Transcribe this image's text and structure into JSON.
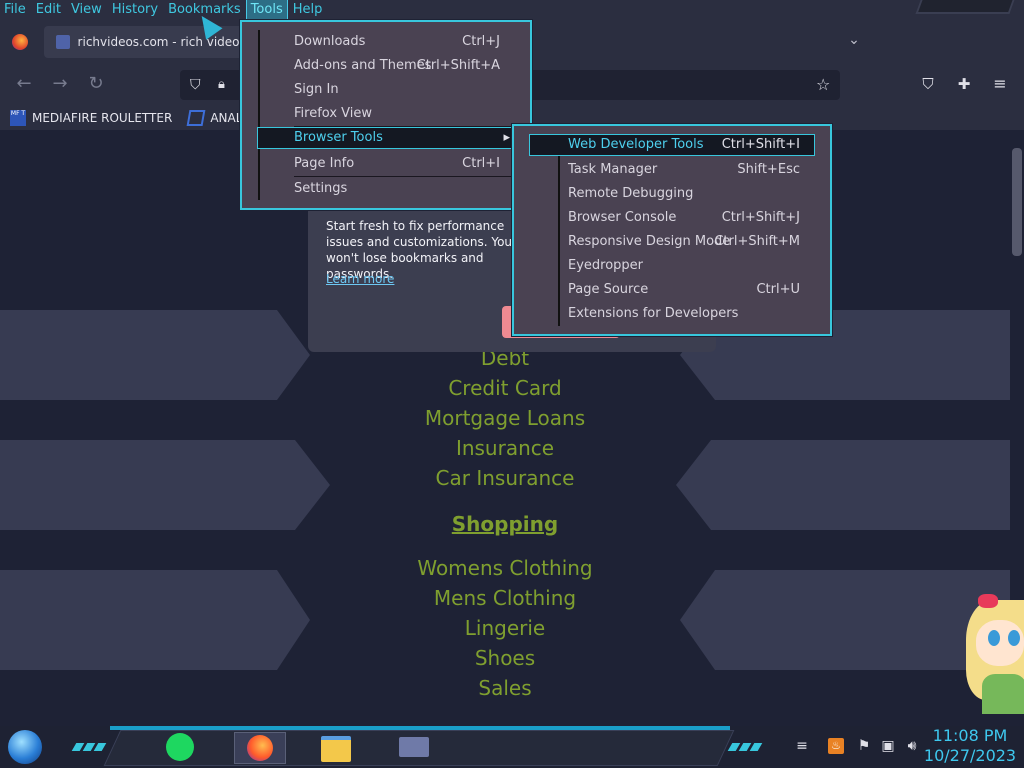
{
  "menubar": {
    "items": [
      "File",
      "Edit",
      "View",
      "History",
      "Bookmarks",
      "Tools",
      "Help"
    ]
  },
  "tab": {
    "title": "richvideos.com - rich videos R"
  },
  "bookmarks": {
    "items": [
      "MEDIAFIRE ROULETTER",
      "ANAL PRO"
    ],
    "icon_text": "MF T"
  },
  "page": {
    "links_top": [
      "Debt",
      "Credit Card",
      "Mortgage Loans",
      "Insurance",
      "Car Insurance"
    ],
    "section_title": "Shopping",
    "links_bottom": [
      "Womens Clothing",
      "Mens Clothing",
      "Lingerie",
      "Shoes",
      "Sales"
    ]
  },
  "popup": {
    "text": "Start fresh to fix performance issues and customizations. You won't lose bookmarks and passwords.",
    "link": "Learn more"
  },
  "tools_menu": {
    "items": [
      {
        "label": "Downloads",
        "shortcut": "Ctrl+J"
      },
      {
        "label": "Add-ons and Themes",
        "shortcut": "Ctrl+Shift+A"
      },
      {
        "label": "Sign In",
        "shortcut": ""
      },
      {
        "label": "Firefox View",
        "shortcut": ""
      },
      {
        "label": "Browser Tools",
        "shortcut": "▸"
      },
      {
        "label": "Page Info",
        "shortcut": "Ctrl+I"
      },
      {
        "label": "Settings",
        "shortcut": ""
      }
    ]
  },
  "browser_tools_menu": {
    "items": [
      {
        "label": "Web Developer Tools",
        "shortcut": "Ctrl+Shift+I"
      },
      {
        "label": "Task Manager",
        "shortcut": "Shift+Esc"
      },
      {
        "label": "Remote Debugging",
        "shortcut": ""
      },
      {
        "label": "Browser Console",
        "shortcut": "Ctrl+Shift+J"
      },
      {
        "label": "Responsive Design Mode",
        "shortcut": "Ctrl+Shift+M"
      },
      {
        "label": "Eyedropper",
        "shortcut": ""
      },
      {
        "label": "Page Source",
        "shortcut": "Ctrl+U"
      },
      {
        "label": "Extensions for Developers",
        "shortcut": ""
      }
    ]
  },
  "clock": {
    "time": "11:08 PM",
    "date": "10/27/2023"
  },
  "colors": {
    "accent": "#38c7dd",
    "link": "#7f9f2f",
    "menu_bg": "#4a4252"
  }
}
